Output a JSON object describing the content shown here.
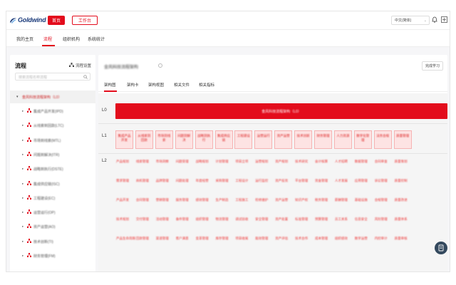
{
  "header": {
    "logo_text": "Goldwind",
    "home_button": "首页",
    "workbench_button": "工作台",
    "language": "中文(简体)"
  },
  "nav": {
    "items": [
      "我的主页",
      "流程",
      "组织机构",
      "系统统计"
    ],
    "active": "流程"
  },
  "sidebar": {
    "title": "流程",
    "settings_label": "流程设置",
    "search_placeholder": "搜索流程名称流程",
    "root_label": "金风科技流程架构（L0）",
    "items": [
      "集成产品开发(IPD)",
      "从线索到回款(LTC)",
      "市场到线索(MTL)",
      "问题到解决(ITR)",
      "战略到执行(DSTE)",
      "集成供应链(ISC)",
      "工程建设(EC)",
      "运营运行(OP)",
      "资产运营(AO)",
      "技术创新(TI)",
      "财务管理(FM)"
    ]
  },
  "main": {
    "title": "金风科技流程架构",
    "complete_button": "完成学习",
    "tabs": [
      "架构图",
      "架构卡",
      "架构视图",
      "相关文件",
      "相关指标"
    ],
    "active_tab": "架构图",
    "levels": [
      "L0",
      "L1",
      "L2"
    ],
    "l0_label": "金风科技流程架构（L0）",
    "l1_items": [
      "集成产品开发",
      "从线索到回款",
      "市场到线索",
      "问题到解决",
      "战略到执行",
      "集成供应链",
      "工程建设",
      "运营运行",
      "资产运营",
      "技术创新",
      "财务管理",
      "人力资源",
      "数字化管理",
      "法务合规",
      "质量管理"
    ],
    "l2_columns": [
      [
        "产品规划",
        "需求管理",
        "产品开发",
        "技术规划",
        "产品生命周期"
      ],
      [
        "线索管理",
        "商机管理",
        "合同管理",
        "交付管理",
        "回款管理"
      ],
      [
        "市场洞察",
        "品牌管理",
        "营销管理",
        "活动管理",
        "渠道管理"
      ],
      [
        "问题受理",
        "问题处理",
        "服务管理",
        "备件管理",
        "客户满意"
      ],
      [
        "战略规划",
        "年度经营",
        "绩效管理",
        "组织管理",
        "变革管理"
      ],
      [
        "计划管理",
        "采购管理",
        "生产制造",
        "物流管理",
        "库存管理"
      ],
      [
        "项目立项",
        "工程设计",
        "工程施工",
        "调试验收",
        "项目收尾"
      ],
      [
        "运营规划",
        "运行监控",
        "检修维护",
        "安全管理",
        "能效管理"
      ],
      [
        "资产规划",
        "资产投资",
        "资产运营",
        "资产处置",
        "资产评估"
      ],
      [
        "技术研究",
        "平台管理",
        "知识产权",
        "标准管理",
        "技术合作"
      ],
      [
        "会计核算",
        "资金管理",
        "税务管理",
        "预算管理",
        "成本管理"
      ],
      [
        "人才招聘",
        "人才发展",
        "薪酬管理",
        "员工关系",
        "组织绩效"
      ],
      [
        "数据管理",
        "应用管理",
        "基础设施",
        "信息安全",
        "数字运营"
      ],
      [
        "合同审查",
        "诉讼管理",
        "合规管理",
        "风险管理",
        "内控审计"
      ],
      [
        "质量策划",
        "质量控制",
        "质量改进",
        "质量体系",
        "质量审核"
      ]
    ]
  }
}
